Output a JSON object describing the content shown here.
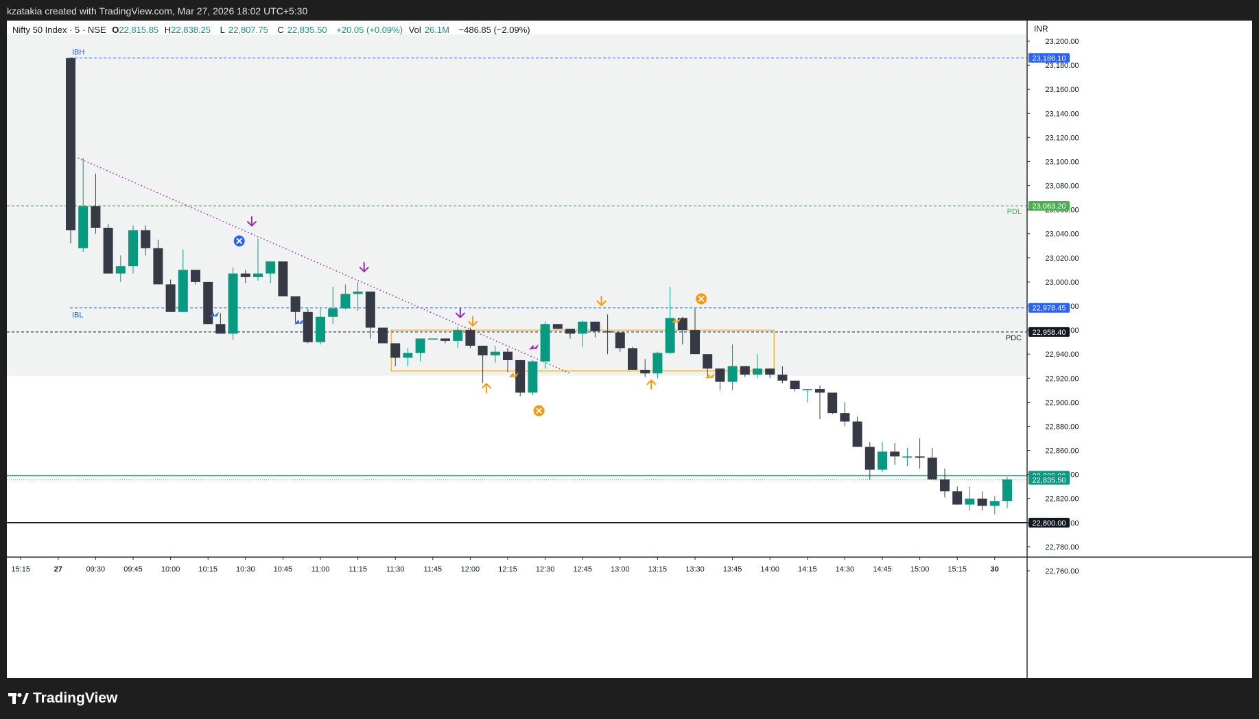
{
  "header": {
    "credit": "kzatakia created with TradingView.com, Mar 27, 2026 18:02 UTC+5:30"
  },
  "legend": {
    "symbol": "Nifty 50 Index · 5 · NSE",
    "o_label": "O",
    "o_value": "22,815.85",
    "h_label": "H",
    "h_value": "22,838.25",
    "l_label": "L",
    "l_value": "22,807.75",
    "c_label": "C",
    "c_value": "22,835.50",
    "change": "+20.05 (+0.09%)",
    "vol_label": "Vol",
    "vol_value": "26.1M",
    "vol_change": "−486.85 (−2.09%)"
  },
  "currency": "INR",
  "brand": {
    "name": "TradingView"
  },
  "colors": {
    "up": "#089981",
    "down": "#363a45",
    "ib_line": "#2962ff",
    "pdl": "#4caf50",
    "box": "#ff9800",
    "trend": "#9c27b0",
    "bg_zone": "#f0f3f2"
  },
  "chart_data": {
    "type": "candlestick",
    "ylim": [
      22750,
      23220
    ],
    "y_ticks": [
      "23,200.00",
      "23,180.00",
      "23,160.00",
      "23,140.00",
      "23,120.00",
      "23,100.00",
      "23,080.00",
      "23,060.00",
      "23,040.00",
      "23,020.00",
      "23,000.00",
      "22,980.00",
      "22,960.00",
      "22,940.00",
      "22,920.00",
      "22,900.00",
      "22,880.00",
      "22,860.00",
      "22,840.00",
      "22,820.00",
      "22,800.00",
      "22,780.00",
      "22,760.00"
    ],
    "x_ticks": [
      {
        "label": "15:15",
        "i": -4
      },
      {
        "label": "27",
        "i": -1
      },
      {
        "label": "09:30",
        "i": 2
      },
      {
        "label": "09:45",
        "i": 5
      },
      {
        "label": "10:00",
        "i": 8
      },
      {
        "label": "10:15",
        "i": 11
      },
      {
        "label": "10:30",
        "i": 14
      },
      {
        "label": "10:45",
        "i": 17
      },
      {
        "label": "11:00",
        "i": 20
      },
      {
        "label": "11:15",
        "i": 23
      },
      {
        "label": "11:30",
        "i": 26
      },
      {
        "label": "11:45",
        "i": 29
      },
      {
        "label": "12:00",
        "i": 32
      },
      {
        "label": "12:15",
        "i": 35
      },
      {
        "label": "12:30",
        "i": 38
      },
      {
        "label": "12:45",
        "i": 41
      },
      {
        "label": "13:00",
        "i": 44
      },
      {
        "label": "13:15",
        "i": 47
      },
      {
        "label": "13:30",
        "i": 50
      },
      {
        "label": "13:45",
        "i": 53
      },
      {
        "label": "14:00",
        "i": 56
      },
      {
        "label": "14:15",
        "i": 59
      },
      {
        "label": "14:30",
        "i": 62
      },
      {
        "label": "14:45",
        "i": 65
      },
      {
        "label": "15:00",
        "i": 68
      },
      {
        "label": "15:15",
        "i": 71
      },
      {
        "label": "30",
        "i": 74
      }
    ],
    "candles": [
      [
        23186,
        23186,
        23032,
        23043
      ],
      [
        23028,
        23103,
        23025,
        23063
      ],
      [
        23063,
        23090,
        23040,
        23045
      ],
      [
        23045,
        23048,
        23010,
        23007
      ],
      [
        23007,
        23022,
        23000,
        23013
      ],
      [
        23013,
        23047,
        23007,
        23043
      ],
      [
        23043,
        23047,
        23022,
        23028
      ],
      [
        23028,
        23035,
        22998,
        22998
      ],
      [
        22998,
        23002,
        22978,
        22975
      ],
      [
        22975,
        23027,
        22975,
        23010
      ],
      [
        23010,
        23010,
        22998,
        23000
      ],
      [
        23000,
        23000,
        22978,
        22965
      ],
      [
        22965,
        22974,
        22963,
        22957
      ],
      [
        22957,
        23012,
        22952,
        23007
      ],
      [
        23007,
        23010,
        22999,
        23004
      ],
      [
        23004,
        23036,
        23001,
        23007
      ],
      [
        23007,
        23017,
        22999,
        23017
      ],
      [
        23017,
        23017,
        22988,
        22988
      ],
      [
        22988,
        22988,
        22966,
        22975
      ],
      [
        22975,
        22978,
        22949,
        22950
      ],
      [
        22950,
        22978,
        22948,
        22971
      ],
      [
        22971,
        22996,
        22965,
        22978
      ],
      [
        22978,
        22998,
        22977,
        22990
      ],
      [
        22990,
        23000,
        22976,
        22992
      ],
      [
        22992,
        22992,
        22953,
        22962
      ],
      [
        22962,
        22962,
        22950,
        22949
      ],
      [
        22949,
        22949,
        22930,
        22937
      ],
      [
        22937,
        22945,
        22930,
        22941
      ],
      [
        22941,
        22953,
        22934,
        22953
      ],
      [
        22953,
        22953,
        22953,
        22953
      ],
      [
        22953,
        22953,
        22949,
        22951
      ],
      [
        22951,
        22963,
        22945,
        22960
      ],
      [
        22960,
        22962,
        22945,
        22947
      ],
      [
        22947,
        22947,
        22916,
        22939
      ],
      [
        22939,
        22947,
        22933,
        22942
      ],
      [
        22942,
        22945,
        22925,
        22935
      ],
      [
        22935,
        22935,
        22905,
        22908
      ],
      [
        22908,
        22935,
        22906,
        22934
      ],
      [
        22934,
        22967,
        22928,
        22965
      ],
      [
        22965,
        22965,
        22961,
        22961
      ],
      [
        22961,
        22961,
        22953,
        22957
      ],
      [
        22957,
        22968,
        22946,
        22967
      ],
      [
        22967,
        22967,
        22954,
        22959
      ],
      [
        22959,
        22973,
        22940,
        22958
      ],
      [
        22958,
        22958,
        22942,
        22945
      ],
      [
        22945,
        22946,
        22927,
        22927
      ],
      [
        22927,
        22936,
        22921,
        22924
      ],
      [
        22924,
        22942,
        22920,
        22941
      ],
      [
        22941,
        22996,
        22940,
        22970
      ],
      [
        22970,
        22971,
        22948,
        22960
      ],
      [
        22960,
        22978,
        22944,
        22940
      ],
      [
        22940,
        22940,
        22920,
        22928
      ],
      [
        22928,
        22928,
        22910,
        22917
      ],
      [
        22917,
        22948,
        22910,
        22930
      ],
      [
        22930,
        22930,
        22921,
        22923
      ],
      [
        22923,
        22940,
        22920,
        22928
      ],
      [
        22928,
        22928,
        22920,
        22923
      ],
      [
        22923,
        22930,
        22916,
        22918
      ],
      [
        22918,
        22918,
        22909,
        22911
      ],
      [
        22911,
        22911,
        22900,
        22911
      ],
      [
        22911,
        22914,
        22886,
        22908
      ],
      [
        22908,
        22908,
        22890,
        22891
      ],
      [
        22891,
        22900,
        22880,
        22884
      ],
      [
        22884,
        22888,
        22872,
        22863
      ],
      [
        22863,
        22867,
        22836,
        22844
      ],
      [
        22844,
        22867,
        22842,
        22859
      ],
      [
        22859,
        22866,
        22848,
        22855
      ],
      [
        22855,
        22862,
        22847,
        22855
      ],
      [
        22855,
        22870,
        22845,
        22854
      ],
      [
        22854,
        22862,
        22838,
        22836
      ],
      [
        22836,
        22845,
        22821,
        22826
      ],
      [
        22826,
        22830,
        22816,
        22815
      ],
      [
        22815,
        22830,
        22810,
        22820
      ],
      [
        22820,
        22826,
        22810,
        22814
      ],
      [
        22814,
        22822,
        22807,
        22818
      ],
      [
        22818,
        22838,
        22812,
        22836
      ]
    ],
    "levels": [
      {
        "name": "IBH",
        "price": 23186.1,
        "label": "23,186.10",
        "color": "#2962ff",
        "style": "dashed"
      },
      {
        "name": "PDL",
        "price": 23063.2,
        "label": "23,063.20",
        "color": "#4caf50",
        "style": "dashed"
      },
      {
        "name": "IBL",
        "price": 22978.45,
        "label": "22,978.45",
        "color": "#2962ff",
        "style": "dashed"
      },
      {
        "name": "PDC",
        "price": 22958.4,
        "label": "22,958.40",
        "color": "#131722",
        "style": "dashed"
      },
      {
        "name": "",
        "price": 22839.0,
        "label": "22,839.00",
        "color": "#089981",
        "style": "solid"
      },
      {
        "name": "",
        "price": 22835.5,
        "label": "22,835.50",
        "color": "#089981",
        "style": "dotted"
      },
      {
        "name": "",
        "price": 22800.0,
        "label": "22,800.00",
        "color": "#131722",
        "style": "solid"
      }
    ],
    "ib_zone": [
      22922,
      23220
    ],
    "box": {
      "i0": 26,
      "i1": 56,
      "top": 22960,
      "bottom": 22926
    },
    "trendline": {
      "i0": 0.6,
      "p0": 23103,
      "i1": 40,
      "p1": 22924
    },
    "markers": [
      {
        "i": 14.5,
        "p": 23050,
        "kind": "arrow-down",
        "color": "#9c27b0"
      },
      {
        "i": 23.5,
        "p": 23012,
        "kind": "arrow-down",
        "color": "#9c27b0"
      },
      {
        "i": 31.2,
        "p": 22974,
        "kind": "arrow-down",
        "color": "#9c27b0"
      },
      {
        "i": 32.2,
        "p": 22967,
        "kind": "arrow-down",
        "color": "#ff9800"
      },
      {
        "i": 42.5,
        "p": 22984,
        "kind": "arrow-down",
        "color": "#ff9800"
      },
      {
        "i": 33.3,
        "p": 22912,
        "kind": "arrow-up",
        "color": "#ff9800"
      },
      {
        "i": 46.5,
        "p": 22915,
        "kind": "arrow-up",
        "color": "#ff9800"
      },
      {
        "i": 13.5,
        "p": 23034,
        "kind": "x-circle",
        "color": "#2962ff"
      },
      {
        "i": 37.5,
        "p": 22893,
        "kind": "x-circle",
        "color": "#ff9800"
      },
      {
        "i": 50.5,
        "p": 22986,
        "kind": "x-circle",
        "color": "#ff9800"
      },
      {
        "i": 11.5,
        "p": 22973,
        "kind": "flag",
        "color": "#2962ff"
      },
      {
        "i": 18.3,
        "p": 22967,
        "kind": "flag",
        "color": "#2962ff"
      },
      {
        "i": 37.1,
        "p": 22946,
        "kind": "flag",
        "color": "#9c27b0"
      },
      {
        "i": 35.5,
        "p": 22923,
        "kind": "flag",
        "color": "#ff9800"
      },
      {
        "i": 48.5,
        "p": 22968,
        "kind": "flag",
        "color": "#ff9800"
      },
      {
        "i": 51.2,
        "p": 22922,
        "kind": "flag",
        "color": "#ff9800"
      }
    ]
  }
}
